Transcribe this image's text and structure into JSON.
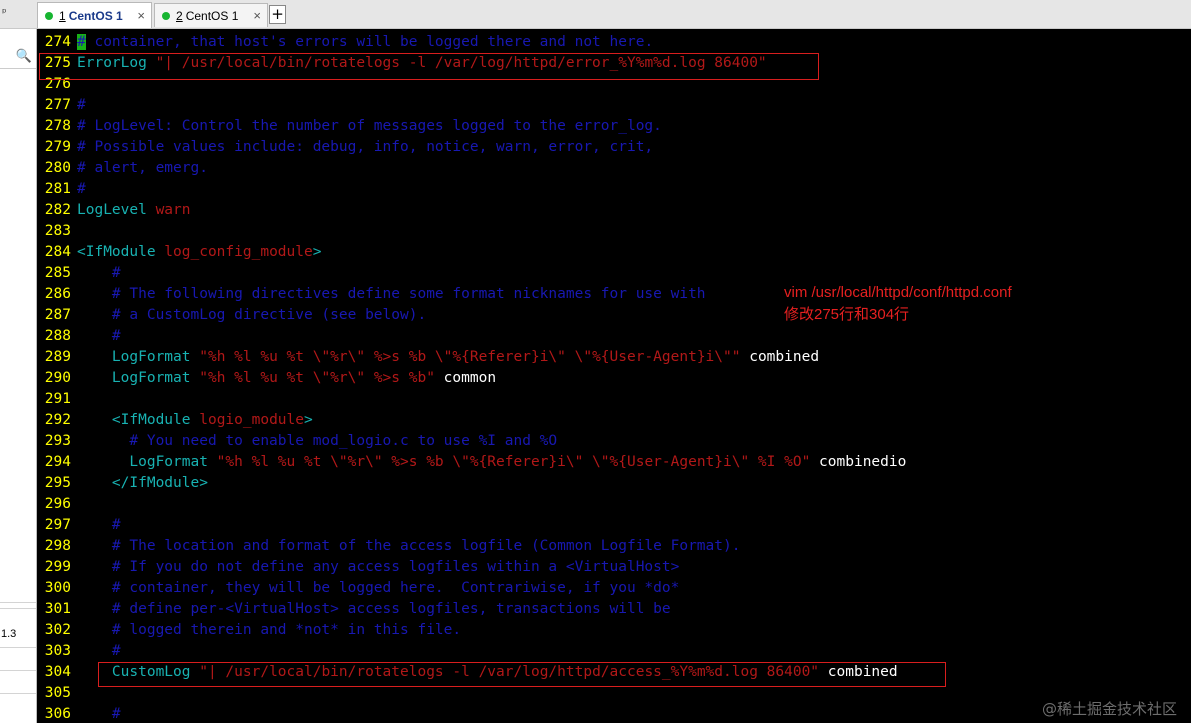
{
  "tabs": [
    {
      "num": "1",
      "label": "CentOS 1",
      "close": "×"
    },
    {
      "num": "2",
      "label": "CentOS 1",
      "close": "×"
    }
  ],
  "sidebar": {
    "pin": "ᵖ",
    "search": "🔍",
    "value": "1.3"
  },
  "new_tab": "+",
  "annotation": {
    "line1": "vim /usr/local/httpd/conf/httpd.conf",
    "line2": "修改275行和304行"
  },
  "watermark": "@稀土掘金技术社区",
  "lines": [
    {
      "n": "274",
      "cursor": "#",
      "comment": " container, that host's errors will be logged there and not here."
    },
    {
      "n": "275",
      "kw": "ErrorLog",
      "arg": " \"| /usr/local/bin/rotatelogs -l /var/log/httpd/error_%Y%m%d.log 86400\""
    },
    {
      "n": "276"
    },
    {
      "n": "277",
      "comment": "#"
    },
    {
      "n": "278",
      "comment": "# LogLevel: Control the number of messages logged to the error_log."
    },
    {
      "n": "279",
      "comment": "# Possible values include: debug, info, notice, warn, error, crit,"
    },
    {
      "n": "280",
      "comment": "# alert, emerg."
    },
    {
      "n": "281",
      "comment": "#"
    },
    {
      "n": "282",
      "kw": "LogLevel",
      "arg": " warn"
    },
    {
      "n": "283"
    },
    {
      "n": "284",
      "kw": "<IfModule",
      "arg": " log_config_module",
      "kw2": ">"
    },
    {
      "n": "285",
      "comment": "    #"
    },
    {
      "n": "286",
      "comment": "    # The following directives define some format nicknames for use with"
    },
    {
      "n": "287",
      "comment": "    # a CustomLog directive (see below)."
    },
    {
      "n": "288",
      "comment": "    #"
    },
    {
      "n": "289",
      "kw": "    LogFormat",
      "arg": " \"%h %l %u %t \\\"%r\\\" %>s %b \\\"%{Referer}i\\\" \\\"%{User-Agent}i\\\"\"",
      "txt": " combined"
    },
    {
      "n": "290",
      "kw": "    LogFormat",
      "arg": " \"%h %l %u %t \\\"%r\\\" %>s %b\"",
      "txt": " common"
    },
    {
      "n": "291"
    },
    {
      "n": "292",
      "kw": "    <IfModule",
      "arg": " logio_module",
      "kw2": ">"
    },
    {
      "n": "293",
      "comment": "      # You need to enable mod_logio.c to use %I and %O"
    },
    {
      "n": "294",
      "kw": "      LogFormat",
      "arg": " \"%h %l %u %t \\\"%r\\\" %>s %b \\\"%{Referer}i\\\" \\\"%{User-Agent}i\\\" %I %O\"",
      "txt": " combinedio"
    },
    {
      "n": "295",
      "kw": "    </IfModule>"
    },
    {
      "n": "296"
    },
    {
      "n": "297",
      "comment": "    #"
    },
    {
      "n": "298",
      "comment": "    # The location and format of the access logfile (Common Logfile Format)."
    },
    {
      "n": "299",
      "comment": "    # If you do not define any access logfiles within a <VirtualHost>"
    },
    {
      "n": "300",
      "comment": "    # container, they will be logged here.  Contrariwise, if you *do*"
    },
    {
      "n": "301",
      "comment": "    # define per-<VirtualHost> access logfiles, transactions will be"
    },
    {
      "n": "302",
      "comment": "    # logged therein and *not* in this file."
    },
    {
      "n": "303",
      "comment": "    #"
    },
    {
      "n": "304",
      "kw": "    CustomLog",
      "arg": " \"| /usr/local/bin/rotatelogs -l /var/log/httpd/access_%Y%m%d.log 86400\"",
      "txt": " combined"
    },
    {
      "n": "305"
    },
    {
      "n": "306",
      "comment": "    #"
    }
  ],
  "colors": {
    "line_number": "#ffff00",
    "comment": "#1818b2",
    "directive": "#18b2b2",
    "argument": "#b21818",
    "highlight_box": "#d81e1e",
    "tab_status_dot": "#17b531"
  }
}
